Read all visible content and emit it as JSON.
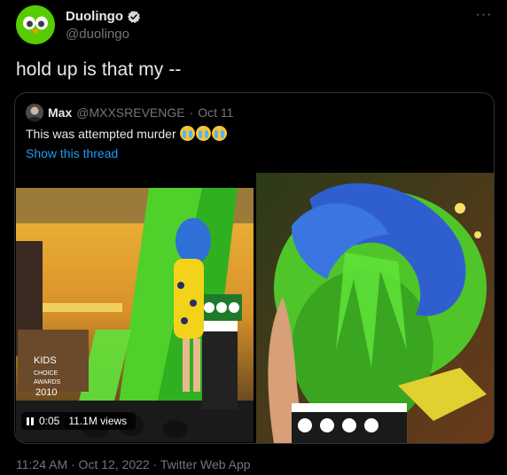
{
  "tweet": {
    "author_name": "Duolingo",
    "author_handle": "@duolingo",
    "text": "hold up is that my --",
    "timestamp": "11:24 AM · Oct 12, 2022 · Twitter Web App",
    "more_icon": "more-icon"
  },
  "quote": {
    "author_name": "Max",
    "author_handle": "@MXXSREVENGE",
    "separator": "·",
    "date": "Oct 11",
    "text": "This was attempted murder",
    "emojis": [
      "loudly-crying-face",
      "loudly-crying-face",
      "loudly-crying-face"
    ],
    "show_thread": "Show this thread",
    "video": {
      "time": "0:05",
      "views": "11.1M views",
      "state": "paused"
    }
  },
  "colors": {
    "background": "#000000",
    "text": "#e7e9ea",
    "muted": "#71767b",
    "link": "#1d9bf0",
    "border": "#2f3336",
    "slime_green": "#58cc02"
  }
}
